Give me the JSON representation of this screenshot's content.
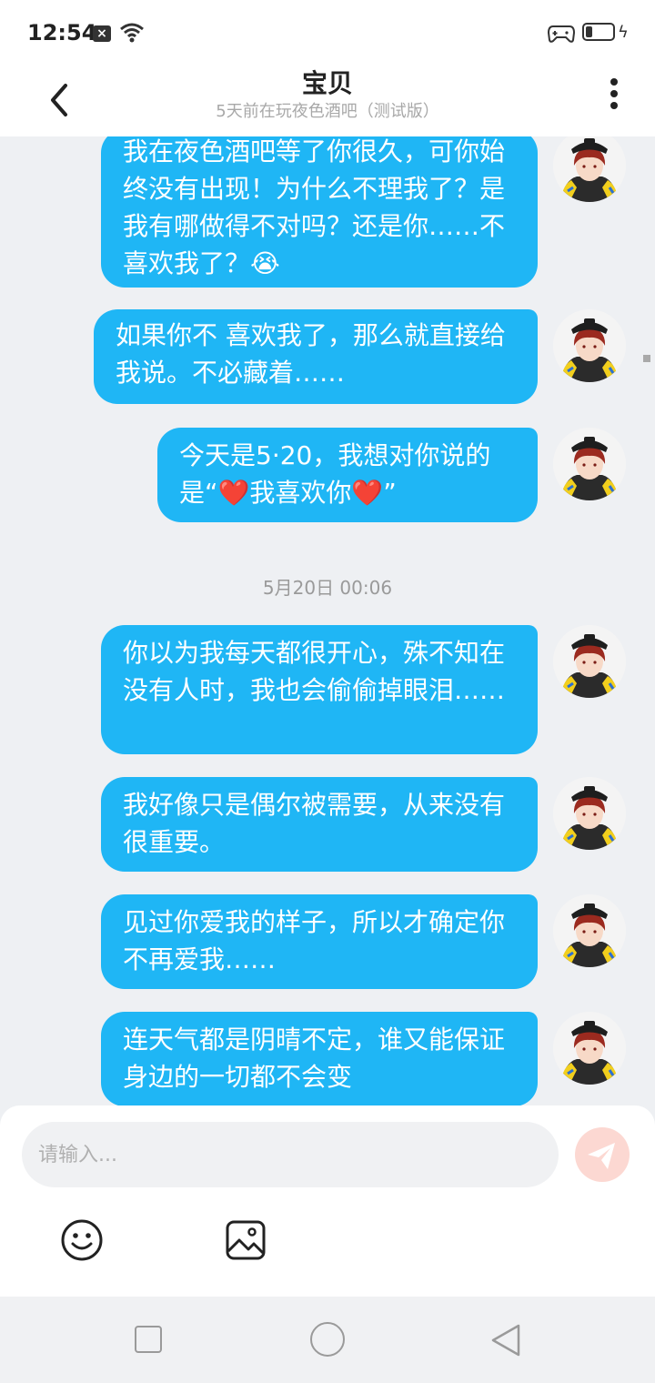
{
  "status_bar": {
    "time": "12:54",
    "notification_icon": "close-box-icon",
    "wifi_icon": "wifi-icon",
    "game_icon": "gamepad-icon",
    "battery_level": 0.25
  },
  "header": {
    "title": "宝贝",
    "subtitle": "5天前在玩夜色酒吧（测试版）"
  },
  "messages": [
    {
      "text": "我在夜色酒吧等了你很久，可你始终没有出现！为什么不理我了？是我有哪做得不对吗？还是你……不喜欢我了？😭"
    },
    {
      "text": "如果你不 喜欢我了，那么就直接给我说。不必藏着……"
    },
    {
      "text": "今天是5·20，我想对你说的是“❤️我喜欢你❤️”"
    },
    {
      "text": "你以为我每天都很开心，殊不知在没有人时，我也会偷偷掉眼泪……"
    },
    {
      "text": "我好像只是偶尔被需要，从来没有很重要。"
    },
    {
      "text": "见过你爱我的样子，所以才确定你不再爱我……"
    },
    {
      "text": "连天气都是阴晴不定，谁又能保证身边的一切都不会变"
    }
  ],
  "time_separator": "5月20日 00:06",
  "input": {
    "placeholder": "请输入..."
  },
  "colors": {
    "bubble": "#1fb6f5",
    "send_button": "#fcd8d2",
    "send_icon": "#ffffff"
  }
}
